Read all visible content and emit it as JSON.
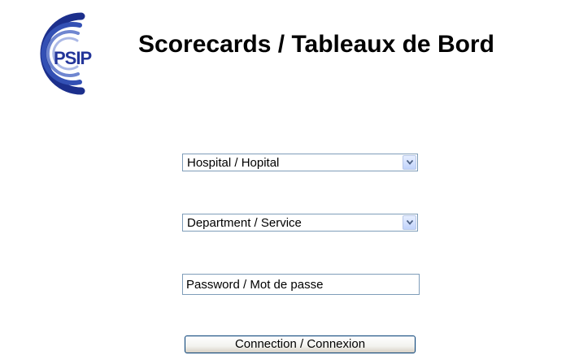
{
  "header": {
    "logo_text": "PSIP",
    "title": "Scorecards / Tableaux de Bord"
  },
  "form": {
    "hospital_select": {
      "selected": "Hospital / Hopital",
      "icon": "chevron-down-icon"
    },
    "department_select": {
      "selected": "Department / Service",
      "icon": "chevron-down-icon"
    },
    "password_field": {
      "value": "Password / Mot de passe"
    },
    "connect_button": {
      "label": "Connection / Connexion"
    }
  },
  "colors": {
    "logo_blue": "#1c2f8c",
    "field_border": "#7f9db9",
    "arrow_blue": "#4d6185"
  }
}
